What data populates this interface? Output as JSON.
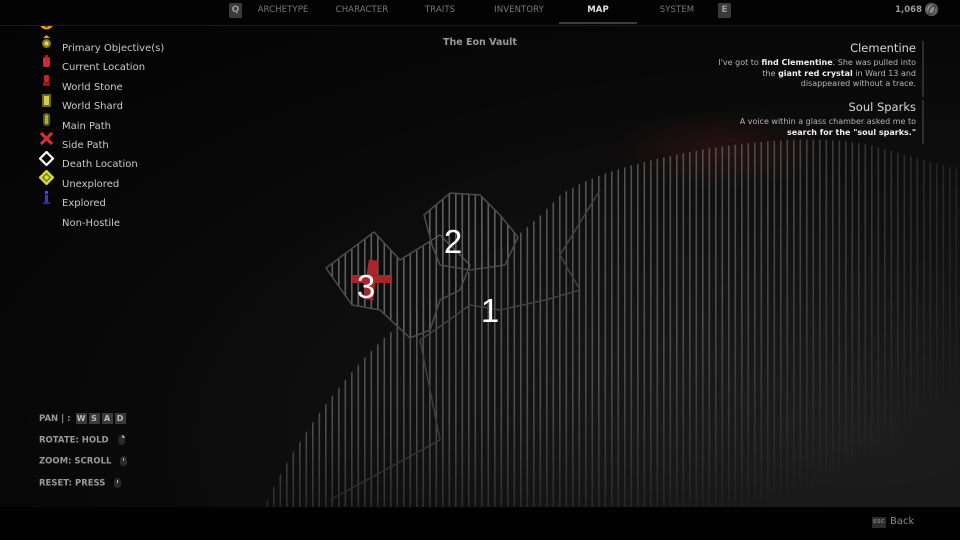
{
  "topbar": {
    "prev_key": "Q",
    "next_key": "E",
    "tabs": [
      {
        "label": "ARCHETYPE",
        "active": false
      },
      {
        "label": "CHARACTER",
        "active": false
      },
      {
        "label": "TRAITS",
        "active": false
      },
      {
        "label": "INVENTORY",
        "active": false
      },
      {
        "label": "MAP",
        "active": true
      },
      {
        "label": "SYSTEM",
        "active": false
      }
    ],
    "currency_amount": "1,068",
    "currency_icon": "scrap-coin-icon"
  },
  "map": {
    "title": "The Eon Vault",
    "zones": [
      {
        "label": "1",
        "name": "zone-1"
      },
      {
        "label": "2",
        "name": "zone-2"
      },
      {
        "label": "3",
        "name": "zone-3"
      }
    ],
    "death_marker": "death-location-marker",
    "colors": {
      "zone_outline": "#4a4a4a",
      "hatch": "#6a6a6a",
      "death_marker": "#a8262a",
      "zone_label": "#ffffff"
    }
  },
  "legend": {
    "items": [
      {
        "label": "Primary Objective(s)",
        "icon": "primary-objective-icon",
        "color": "#e89a10"
      },
      {
        "label": "Current Location",
        "icon": "current-location-icon",
        "color": "#c9b320"
      },
      {
        "label": "World Stone",
        "icon": "world-stone-icon",
        "color": "#d02a2a"
      },
      {
        "label": "World Shard",
        "icon": "world-shard-icon",
        "color": "#c42626"
      },
      {
        "label": "Main Path",
        "icon": "main-path-icon",
        "color": "#c9c040"
      },
      {
        "label": "Side Path",
        "icon": "side-path-icon",
        "color": "#a9a230"
      },
      {
        "label": "Death Location",
        "icon": "death-location-icon",
        "color": "#d03030"
      },
      {
        "label": "Unexplored",
        "icon": "unexplored-icon",
        "color": "#ffffff"
      },
      {
        "label": "Explored",
        "icon": "explored-icon",
        "color": "#e0dc40"
      },
      {
        "label": "Non-Hostile",
        "icon": "non-hostile-icon",
        "color": "#3a3ad0"
      }
    ]
  },
  "quests": [
    {
      "title": "Clementine",
      "lines": [
        [
          {
            "t": "I've got to "
          },
          {
            "t": "find Clementine",
            "b": true
          },
          {
            "t": ". She was pulled into"
          }
        ],
        [
          {
            "t": "the "
          },
          {
            "t": "giant red crystal",
            "b": true
          },
          {
            "t": " in Ward 13 and"
          }
        ],
        [
          {
            "t": "disappeared without a trace."
          }
        ]
      ]
    },
    {
      "title": "Soul Sparks",
      "lines": [
        [
          {
            "t": "A voice within a glass chamber asked me to"
          }
        ],
        [
          {
            "t": "search for the \"soul sparks.\"",
            "b": true
          }
        ]
      ]
    }
  ],
  "controls": {
    "pan_label": "PAN | :",
    "pan_keys": [
      "W",
      "S",
      "A",
      "D"
    ],
    "rotate_label": "ROTATE: HOLD",
    "zoom_label": "ZOOM: SCROLL",
    "reset_label": "RESET: PRESS"
  },
  "bottombar": {
    "esc_key": "ESC",
    "back_label": "Back"
  }
}
